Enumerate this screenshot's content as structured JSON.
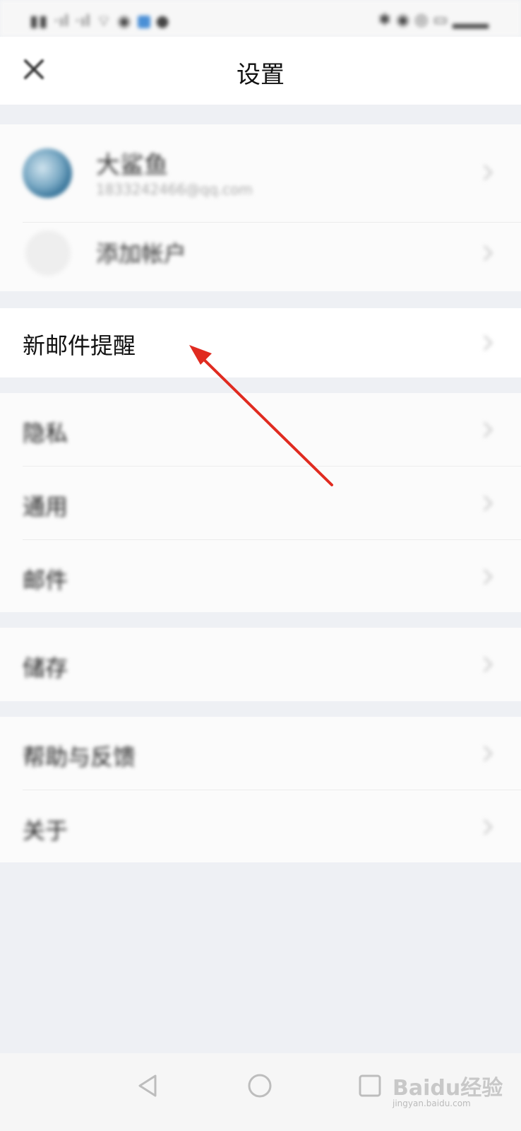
{
  "status_bar": {
    "left_text": "",
    "right_text": ""
  },
  "header": {
    "title": "设置",
    "close_icon": "close-icon"
  },
  "account": {
    "name": "大鲨鱼",
    "email": "1833242466@qq.com"
  },
  "add_account": {
    "label": "添加帐户"
  },
  "menu": {
    "new_mail_alert": "新邮件提醒",
    "privacy": "隐私",
    "general": "通用",
    "mail": "邮件",
    "storage": "储存",
    "help_feedback": "帮助与反馈",
    "about": "关于"
  },
  "nav": {
    "back_icon": "back-triangle-icon",
    "home_icon": "home-circle-icon",
    "recent_icon": "recent-square-icon"
  },
  "watermark": {
    "text": "Baidu经验",
    "sub": "jingyan.baidu.com"
  },
  "colors": {
    "background": "#eef0f4",
    "group": "#fbfbfb",
    "arrow": "#e02b20"
  }
}
